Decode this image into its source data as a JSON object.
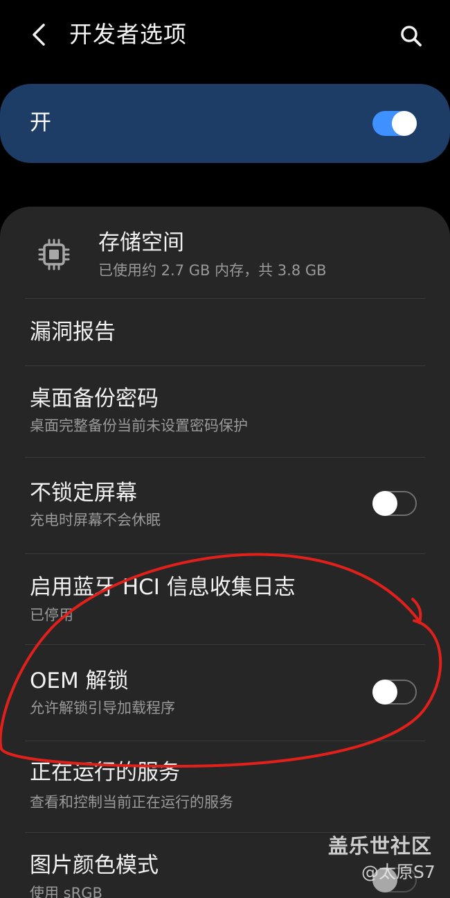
{
  "header": {
    "title": "开发者选项",
    "back_icon": "back-arrow-icon",
    "search_icon": "search-icon"
  },
  "master_switch": {
    "label": "开",
    "state": "on"
  },
  "items": [
    {
      "title": "存储空间",
      "subtitle": "已使用约 2.7 GB 内存，共 3.8 GB",
      "icon": "memory-chip-icon"
    },
    {
      "title": "漏洞报告"
    },
    {
      "title": "桌面备份密码",
      "subtitle": "桌面完整备份当前未设置密码保护"
    },
    {
      "title": "不锁定屏幕",
      "subtitle": "充电时屏幕不会休眠",
      "toggle": "off"
    },
    {
      "title": "启用蓝牙 HCI 信息收集日志",
      "subtitle": "已停用"
    },
    {
      "title": "OEM 解锁",
      "subtitle": "允许解锁引导加载程序",
      "toggle": "off"
    },
    {
      "title": "正在运行的服务",
      "subtitle": "查看和控制当前正在运行的服务"
    },
    {
      "title": "图片颜色模式",
      "subtitle": "使用 sRGB"
    }
  ],
  "watermark": {
    "brand": "盖乐世社区",
    "user": "@太原S7"
  },
  "colors": {
    "background": "#000000",
    "card": "#262626",
    "master_card": "#1e3d66",
    "toggle_on": "#3e91ff",
    "annotation": "#e0201b"
  }
}
